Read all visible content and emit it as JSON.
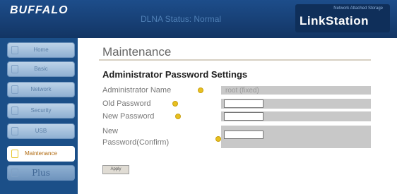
{
  "header": {
    "logo": "BUFFALO",
    "status": "DLNA Status: Normal",
    "brand_small": "Network Attached Storage",
    "brand_main": "LinkStation"
  },
  "sidebar": {
    "items": [
      {
        "label": "Home"
      },
      {
        "label": "Basic"
      },
      {
        "label": "Network"
      },
      {
        "label": "Security"
      },
      {
        "label": "USB"
      },
      {
        "label": "Maintenance"
      },
      {
        "label": "Plus"
      }
    ],
    "active": "Maintenance"
  },
  "main": {
    "title": "Maintenance",
    "section_title": "Administrator Password Settings",
    "admin_name_label": "Administrator Name",
    "admin_name_value": "root (fixed)",
    "old_password_label": "Old Password",
    "new_password_label": "New Password",
    "confirm_label_line1": "New",
    "confirm_label_line2": "Password(Confirm)",
    "apply_label": "Apply"
  },
  "colors": {
    "header": "#173f74",
    "sidebar": "#1b4f88",
    "help_icon": "#e8c020"
  },
  "icons": {
    "help": "help-icon",
    "nav": "page-icon"
  }
}
